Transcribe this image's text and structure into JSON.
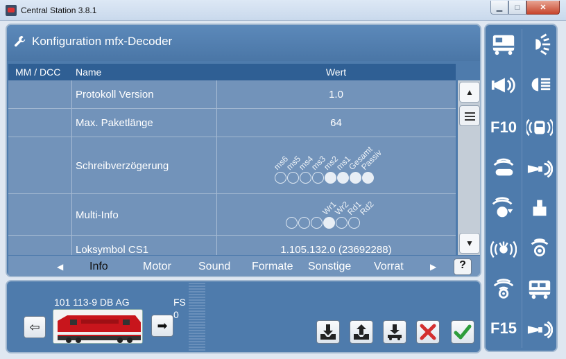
{
  "window": {
    "title": "Central Station 3.8.1"
  },
  "main": {
    "title": "Konfiguration mfx-Decoder",
    "columns": [
      "MM / DCC",
      "Name",
      "Wert"
    ],
    "rows": [
      {
        "name": "Protokoll Version",
        "value": "1.0"
      },
      {
        "name": "Max. Paketlänge",
        "value": "64"
      },
      {
        "name": "Schreibverzögerung",
        "value": ""
      },
      {
        "name": "Multi-Info",
        "value": ""
      },
      {
        "name": "Loksymbol CS1",
        "value": "1.105.132.0 (23692288)"
      }
    ],
    "schreib_labels": [
      "ms6",
      "ms5",
      "ms4",
      "ms3",
      "ms2",
      "ms1",
      "Gesamt",
      "Passiv"
    ],
    "schreib_state": [
      false,
      false,
      false,
      false,
      true,
      true,
      true,
      true
    ],
    "multi_labels": [
      "Wr1",
      "Wr2",
      "Rd1",
      "Rd2"
    ],
    "multi_state": [
      false,
      false,
      false,
      true,
      false,
      false
    ]
  },
  "tabs": {
    "items": [
      "Info",
      "Motor",
      "Sound",
      "Formate",
      "Sonstige",
      "Vorrat"
    ],
    "active": "Info",
    "help": "?"
  },
  "loco": {
    "name": "101 113-9 DB AG",
    "fs_label": "FS",
    "fs_value": "0"
  },
  "functions": {
    "f10_label": "F10",
    "f15_label": "F15"
  },
  "colors": {
    "panel": "#4e7bac",
    "header": "#2f5f94",
    "accent_red": "#d32f2f",
    "accent_green": "#2e9d3b"
  }
}
